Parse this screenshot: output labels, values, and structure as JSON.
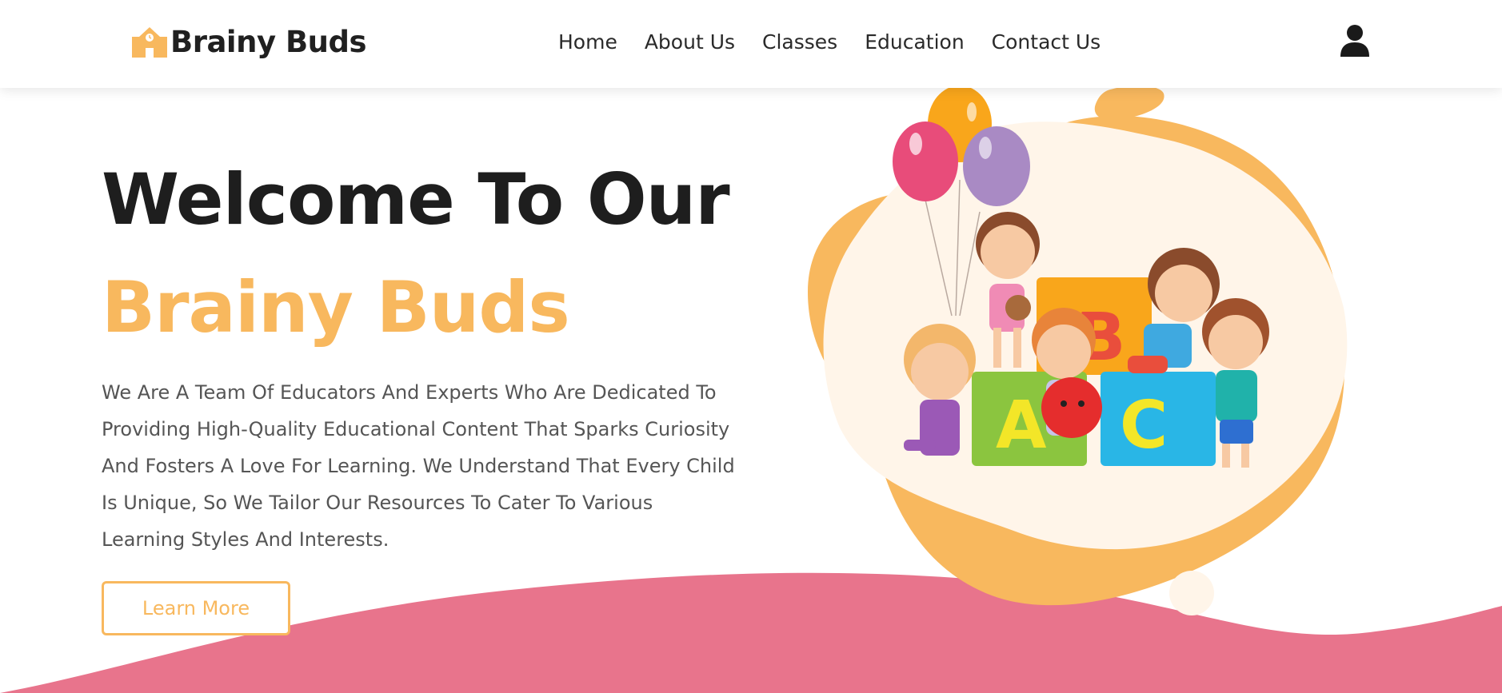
{
  "header": {
    "brand": "Brainy Buds",
    "logo_icon": "school-building-icon",
    "nav": [
      {
        "label": "Home"
      },
      {
        "label": "About Us"
      },
      {
        "label": "Classes"
      },
      {
        "label": "Education"
      },
      {
        "label": "Contact Us"
      }
    ],
    "account_icon": "user-icon"
  },
  "hero": {
    "title_line1": "Welcome To Our",
    "title_line2": "Brainy Buds",
    "description": "We Are A Team Of Educators And Experts Who Are Dedicated To Providing High-Quality Educational Content That Sparks Curiosity And Fosters A Love For Learning. We Understand That Every Child Is Unique, So We Tailor Our Resources To Cater To Various Learning Styles And Interests.",
    "cta_label": "Learn More",
    "illustration_blocks": [
      "B",
      "A",
      "C"
    ]
  },
  "colors": {
    "accent": "#f8b85e",
    "wave": "#e8748c",
    "text_dark": "#1e1e1e",
    "text_body": "#555555"
  }
}
